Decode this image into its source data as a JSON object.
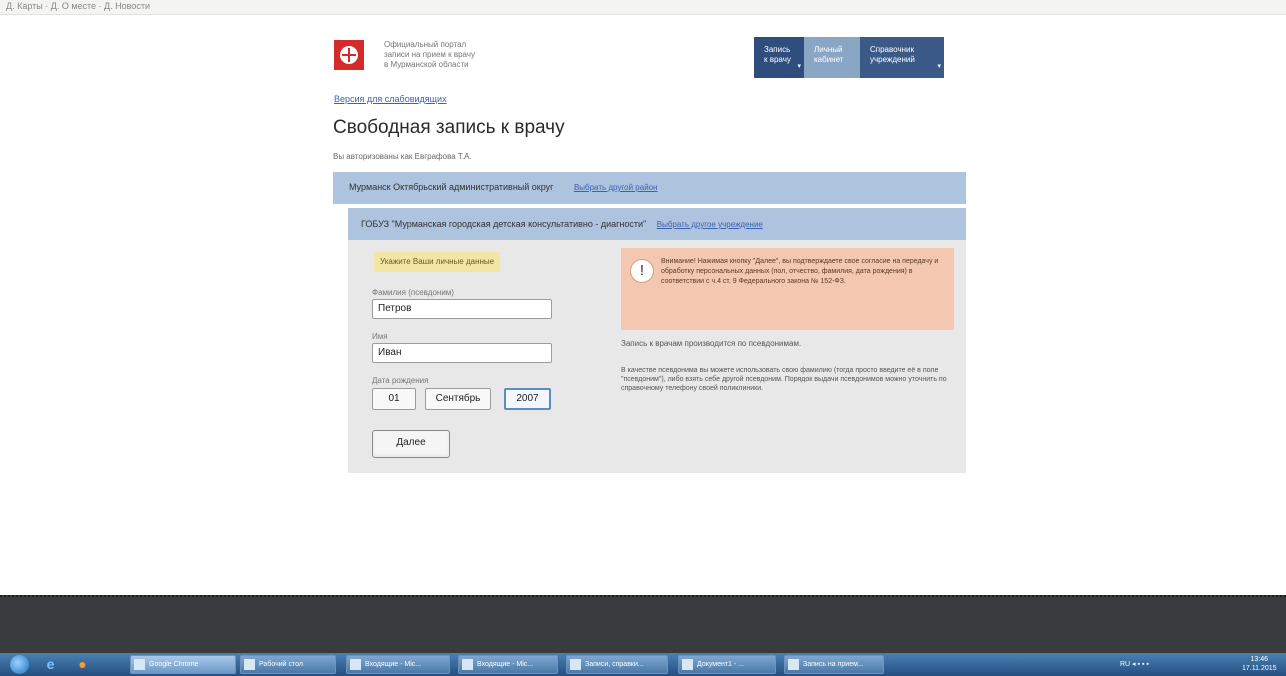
{
  "browser": {
    "bookmarks_text": "Д. Карты · Д. О месте · Д. Новости"
  },
  "header": {
    "portal_lines": [
      "Официальный портал",
      "записи на прием к врачу",
      "в Мурманской области"
    ],
    "nav": [
      {
        "line1": "Запись",
        "line2": "к врачу",
        "arrow": "▾"
      },
      {
        "line1": "Личный",
        "line2": "кабинет",
        "arrow": ""
      },
      {
        "line1": "Справочник",
        "line2": "учреждений",
        "arrow": "▾"
      }
    ]
  },
  "version_link": "Версия для слабовидящих",
  "page_title": "Свободная запись к врачу",
  "auth_text": "Вы авторизованы как Евграфова Т.А.",
  "district": {
    "text": "Мурманск Октябрьский административный округ",
    "link": "Выбрать другой район"
  },
  "institution": {
    "text": "ГОБУЗ \"Мурманская городская детская консультативно - диагности\"",
    "link": "Выбрать другое учреждение"
  },
  "form": {
    "notice": "Укажите Ваши личные данные",
    "surname_label": "Фамилия (псевдоним)",
    "surname_value": "Петров",
    "name_label": "Имя",
    "name_value": "Иван",
    "dob_label": "Дата рождения",
    "dob_day": "01",
    "dob_month": "Сентябрь",
    "dob_year": "2007",
    "next_button": "Далее"
  },
  "info": {
    "warning_icon": "!",
    "warning_text": "Внимание! Нажимая кнопку \"Далее\", вы подтверждаете свое согласие на передачу и обработку персональных данных (пол, отчество, фамилия, дата рождения) в соответствии с ч.4 ст. 9 Федерального закона № 152-ФЗ.",
    "p1": "Запись к врачам производится по псевдонимам.",
    "p2": "В качестве псевдонима вы можете использовать свою фамилию (тогда просто введите её в поле \"псевдоним\"), либо взять себе другой псевдоним. Порядок выдачи псевдонимов можно уточнить по справочному телефону своей поликлиники."
  },
  "taskbar": {
    "buttons": [
      "Google Chrome",
      "Рабочий стол",
      "Входящие - Mic...",
      "Входящие - Mic...",
      "Записи, справки...",
      "Документ1 - ...",
      "Запись на прием..."
    ],
    "tray_text": "RU  ◂  ▪ ▪ ▪",
    "clock_time": "13:46",
    "clock_date": "17.11.2015"
  }
}
